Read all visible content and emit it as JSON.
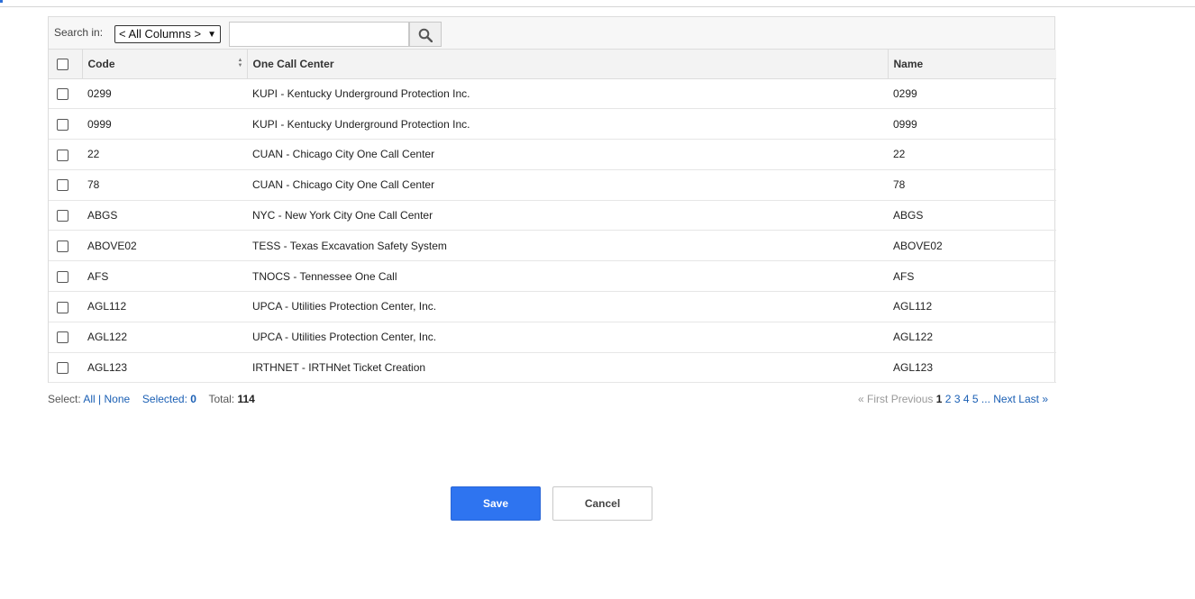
{
  "search": {
    "label": "Search in:",
    "selected_column": "< All Columns >",
    "query": ""
  },
  "table": {
    "columns": [
      "Code",
      "One Call Center",
      "Name"
    ],
    "rows": [
      {
        "code": "0299",
        "center": "KUPI - Kentucky Underground Protection Inc.",
        "name": "0299"
      },
      {
        "code": "0999",
        "center": "KUPI - Kentucky Underground Protection Inc.",
        "name": "0999"
      },
      {
        "code": "22",
        "center": "CUAN - Chicago City One Call Center",
        "name": "22"
      },
      {
        "code": "78",
        "center": "CUAN - Chicago City One Call Center",
        "name": "78"
      },
      {
        "code": "ABGS",
        "center": "NYC - New York City One Call Center",
        "name": "ABGS"
      },
      {
        "code": "ABOVE02",
        "center": "TESS - Texas Excavation Safety System",
        "name": "ABOVE02"
      },
      {
        "code": "AFS",
        "center": "TNOCS - Tennessee One Call",
        "name": "AFS"
      },
      {
        "code": "AGL112",
        "center": "UPCA - Utilities Protection Center, Inc.",
        "name": "AGL112"
      },
      {
        "code": "AGL122",
        "center": "UPCA - Utilities Protection Center, Inc.",
        "name": "AGL122"
      },
      {
        "code": "AGL123",
        "center": "IRTHNET - IRTHNet Ticket Creation",
        "name": "AGL123"
      }
    ]
  },
  "footer": {
    "select_label": "Select:",
    "all": "All",
    "separator": "|",
    "none": "None",
    "selected_label": "Selected:",
    "selected_count": "0",
    "total_label": "Total:",
    "total_count": "114",
    "first": "« First",
    "previous": "Previous",
    "pages": [
      "1",
      "2",
      "3",
      "4",
      "5"
    ],
    "ellipsis": "...",
    "next": "Next",
    "last": "Last »"
  },
  "actions": {
    "save": "Save",
    "cancel": "Cancel"
  },
  "colors": {
    "accent": "#2e74f0",
    "link": "#1a5fb4"
  }
}
